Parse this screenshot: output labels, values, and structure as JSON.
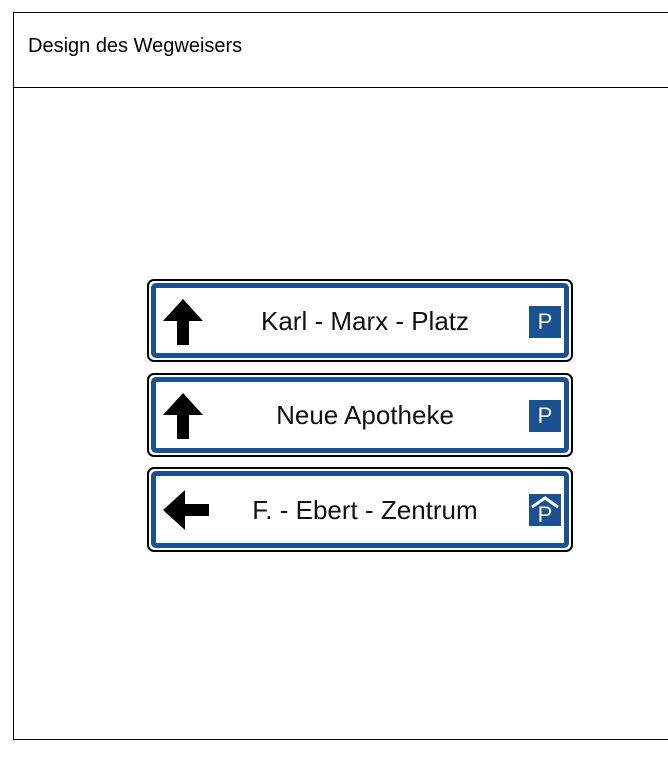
{
  "header": {
    "title": "Design des Wegweisers"
  },
  "signs": [
    {
      "label": "Karl - Marx - Platz",
      "arrow_icon": "arrow-up-icon",
      "parking_letter": "P",
      "parking_icon": "parking-icon"
    },
    {
      "label": "Neue Apotheke",
      "arrow_icon": "arrow-up-icon",
      "parking_letter": "P",
      "parking_icon": "parking-icon"
    },
    {
      "label": "F. - Ebert - Zentrum",
      "arrow_icon": "arrow-left-icon",
      "parking_letter": "P",
      "parking_icon": "parking-garage-icon"
    }
  ],
  "colors": {
    "sign_blue": "#1a5193",
    "frame": "#000000",
    "text": "#111111"
  }
}
